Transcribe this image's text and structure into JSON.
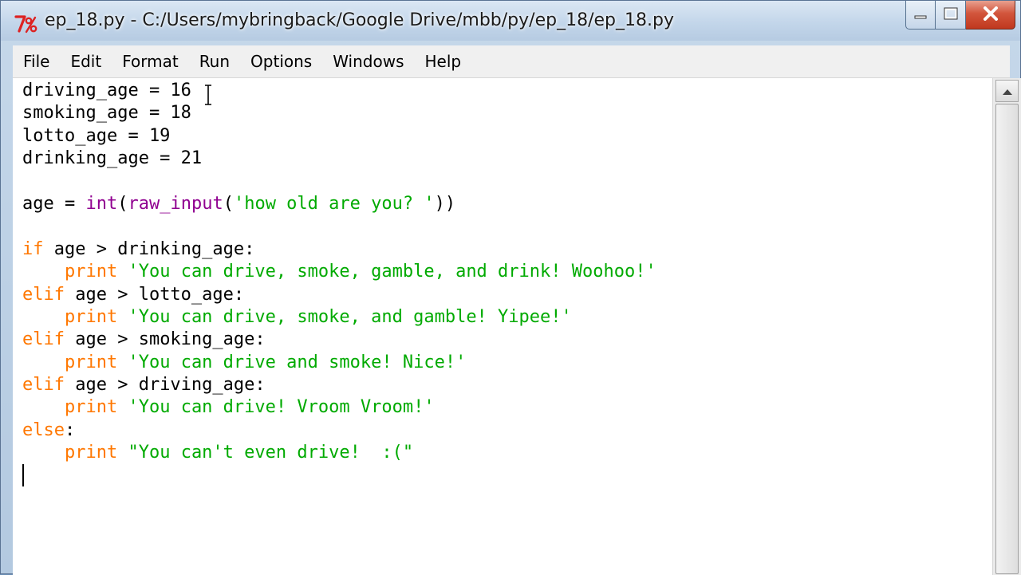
{
  "window": {
    "title": "ep_18.py - C:/Users/mybringback/Google Drive/mbb/py/ep_18/ep_18.py",
    "icons": {
      "app": "idle-python-icon",
      "minimize": "minimize-icon",
      "maximize": "maximize-icon",
      "close": "close-icon"
    }
  },
  "menu": {
    "items": [
      "File",
      "Edit",
      "Format",
      "Run",
      "Options",
      "Windows",
      "Help"
    ]
  },
  "editor": {
    "lines": [
      [
        {
          "t": "driving_age = 16",
          "c": "plain"
        }
      ],
      [
        {
          "t": "smoking_age = 18",
          "c": "plain"
        }
      ],
      [
        {
          "t": "lotto_age = 19",
          "c": "plain"
        }
      ],
      [
        {
          "t": "drinking_age = 21",
          "c": "plain"
        }
      ],
      [],
      [
        {
          "t": "age = ",
          "c": "plain"
        },
        {
          "t": "int",
          "c": "builtin"
        },
        {
          "t": "(",
          "c": "plain"
        },
        {
          "t": "raw_input",
          "c": "builtin"
        },
        {
          "t": "(",
          "c": "plain"
        },
        {
          "t": "'how old are you? '",
          "c": "string"
        },
        {
          "t": "))",
          "c": "plain"
        }
      ],
      [],
      [
        {
          "t": "if",
          "c": "keyword"
        },
        {
          "t": " age > drinking_age:",
          "c": "plain"
        }
      ],
      [
        {
          "t": "    ",
          "c": "plain"
        },
        {
          "t": "print",
          "c": "keyword"
        },
        {
          "t": " ",
          "c": "plain"
        },
        {
          "t": "'You can drive, smoke, gamble, and drink! Woohoo!'",
          "c": "string"
        }
      ],
      [
        {
          "t": "elif",
          "c": "keyword"
        },
        {
          "t": " age > lotto_age:",
          "c": "plain"
        }
      ],
      [
        {
          "t": "    ",
          "c": "plain"
        },
        {
          "t": "print",
          "c": "keyword"
        },
        {
          "t": " ",
          "c": "plain"
        },
        {
          "t": "'You can drive, smoke, and gamble! Yipee!'",
          "c": "string"
        }
      ],
      [
        {
          "t": "elif",
          "c": "keyword"
        },
        {
          "t": " age > smoking_age:",
          "c": "plain"
        }
      ],
      [
        {
          "t": "    ",
          "c": "plain"
        },
        {
          "t": "print",
          "c": "keyword"
        },
        {
          "t": " ",
          "c": "plain"
        },
        {
          "t": "'You can drive and smoke! Nice!'",
          "c": "string"
        }
      ],
      [
        {
          "t": "elif",
          "c": "keyword"
        },
        {
          "t": " age > driving_age:",
          "c": "plain"
        }
      ],
      [
        {
          "t": "    ",
          "c": "plain"
        },
        {
          "t": "print",
          "c": "keyword"
        },
        {
          "t": " ",
          "c": "plain"
        },
        {
          "t": "'You can drive! Vroom Vroom!'",
          "c": "string"
        }
      ],
      [
        {
          "t": "else",
          "c": "keyword"
        },
        {
          "t": ":",
          "c": "plain"
        }
      ],
      [
        {
          "t": "    ",
          "c": "plain"
        },
        {
          "t": "print",
          "c": "keyword"
        },
        {
          "t": " ",
          "c": "plain"
        },
        {
          "t": "\"You can't even drive!  :(\"",
          "c": "string"
        }
      ],
      []
    ]
  },
  "colors": {
    "keyword": "#ff7700",
    "builtin": "#900090",
    "string": "#00aa00",
    "plain": "#000000",
    "menubar": "#f0f0f0",
    "titlebar": "#c3d6ea",
    "close_button": "#c0381e"
  }
}
